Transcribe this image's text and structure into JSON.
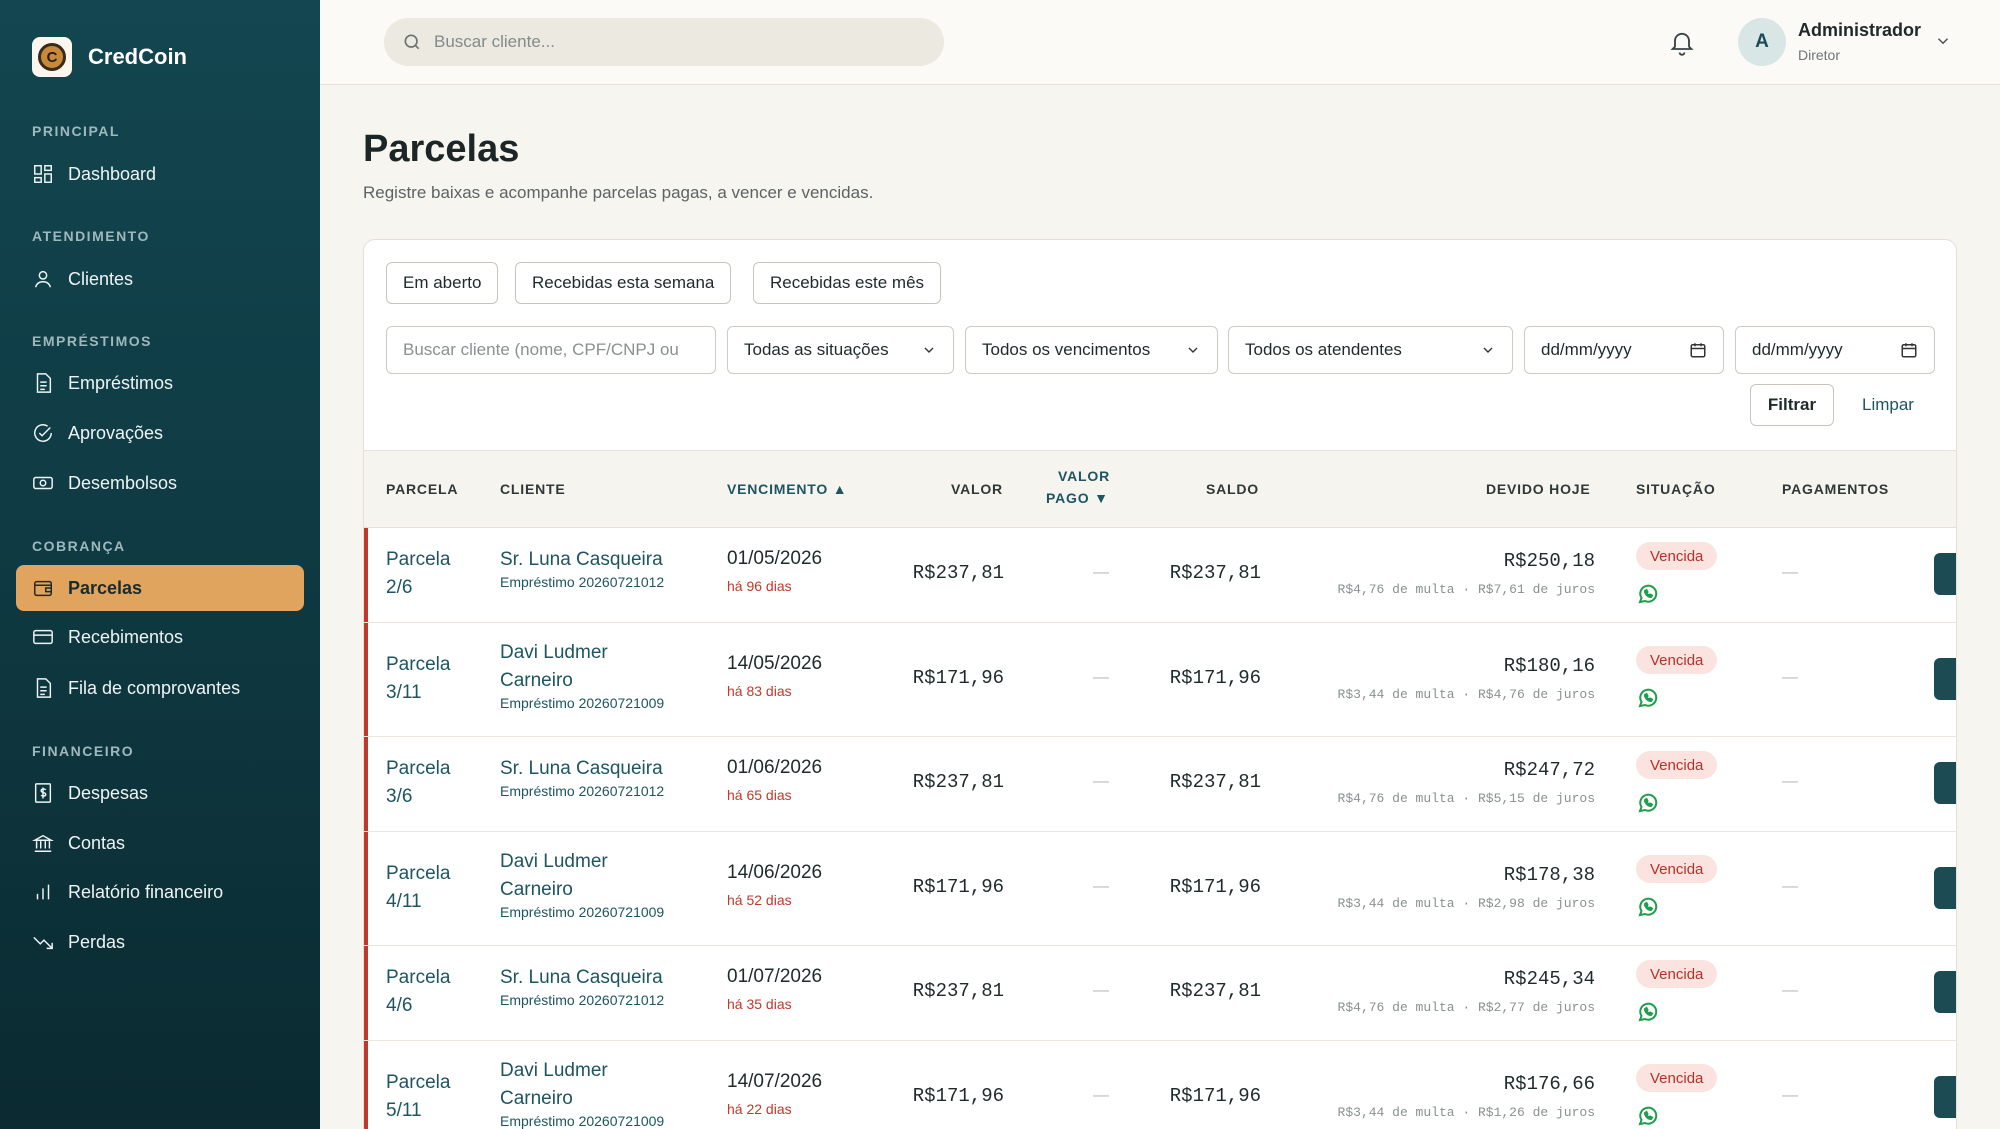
{
  "brand": {
    "name": "CredCoin",
    "logo_letter": "C"
  },
  "sidebar": {
    "sections": [
      {
        "label": "PRINCIPAL",
        "items": [
          {
            "label": "Dashboard",
            "icon": "grid-icon"
          }
        ]
      },
      {
        "label": "ATENDIMENTO",
        "items": [
          {
            "label": "Clientes",
            "icon": "user-icon"
          }
        ]
      },
      {
        "label": "EMPRÉSTIMOS",
        "items": [
          {
            "label": "Empréstimos",
            "icon": "document-icon"
          },
          {
            "label": "Aprovações",
            "icon": "check-circle-icon"
          },
          {
            "label": "Desembolsos",
            "icon": "cash-icon"
          }
        ]
      },
      {
        "label": "COBRANÇA",
        "items": [
          {
            "label": "Parcelas",
            "icon": "wallet-icon",
            "active": true
          },
          {
            "label": "Recebimentos",
            "icon": "card-icon"
          },
          {
            "label": "Fila de comprovantes",
            "icon": "document-icon"
          }
        ]
      },
      {
        "label": "FINANCEIRO",
        "items": [
          {
            "label": "Despesas",
            "icon": "dollar-doc-icon"
          },
          {
            "label": "Contas",
            "icon": "bank-icon"
          },
          {
            "label": "Relatório financeiro",
            "icon": "bar-chart-icon"
          },
          {
            "label": "Perdas",
            "icon": "trend-down-icon"
          }
        ]
      }
    ]
  },
  "header": {
    "search_placeholder": "Buscar cliente...",
    "user": {
      "initial": "A",
      "name": "Administrador",
      "role": "Diretor"
    }
  },
  "page": {
    "title": "Parcelas",
    "subtitle": "Registre baixas e acompanhe parcelas pagas, a vencer e vencidas."
  },
  "filters": {
    "chips": [
      "Em aberto",
      "Recebidas esta semana",
      "Recebidas este mês"
    ],
    "search_placeholder": "Buscar cliente (nome, CPF/CNPJ ou",
    "situacao": "Todas as situações",
    "vencimentos": "Todos os vencimentos",
    "atendentes": "Todos os atendentes",
    "date_from": "dd/mm/yyyy",
    "date_to": "dd/mm/yyyy",
    "filter_label": "Filtrar",
    "clear_label": "Limpar"
  },
  "table": {
    "headers": {
      "parcela": "PARCELA",
      "cliente": "CLIENTE",
      "vencimento": "VENCIMENTO ▲",
      "valor": "VALOR",
      "valor_pago_1": "VALOR",
      "valor_pago_2": "PAGO ▼",
      "saldo": "SALDO",
      "devido_hoje": "DEVIDO HOJE",
      "situacao": "SITUAÇÃO",
      "pagamentos": "PAGAMENTOS"
    },
    "rows": [
      {
        "parcela_1": "Parcela",
        "parcela_2": "2/6",
        "cliente_1": "Sr. Luna Casqueira",
        "cliente_2": "",
        "emprestimo": "Empréstimo 20260721012",
        "venc": "01/05/2026",
        "atraso": "há 96 dias",
        "valor": "R$237,81",
        "pago": "—",
        "saldo": "R$237,81",
        "devido": "R$250,18",
        "detalhe": "R$4,76 de multa · R$7,61 de juros",
        "situacao": "Vencida",
        "pagamentos": "—"
      },
      {
        "parcela_1": "Parcela",
        "parcela_2": "3/11",
        "cliente_1": "Davi Ludmer",
        "cliente_2": "Carneiro",
        "emprestimo": "Empréstimo 20260721009",
        "venc": "14/05/2026",
        "atraso": "há 83 dias",
        "valor": "R$171,96",
        "pago": "—",
        "saldo": "R$171,96",
        "devido": "R$180,16",
        "detalhe": "R$3,44 de multa · R$4,76 de juros",
        "situacao": "Vencida",
        "pagamentos": "—"
      },
      {
        "parcela_1": "Parcela",
        "parcela_2": "3/6",
        "cliente_1": "Sr. Luna Casqueira",
        "cliente_2": "",
        "emprestimo": "Empréstimo 20260721012",
        "venc": "01/06/2026",
        "atraso": "há 65 dias",
        "valor": "R$237,81",
        "pago": "—",
        "saldo": "R$237,81",
        "devido": "R$247,72",
        "detalhe": "R$4,76 de multa · R$5,15 de juros",
        "situacao": "Vencida",
        "pagamentos": "—"
      },
      {
        "parcela_1": "Parcela",
        "parcela_2": "4/11",
        "cliente_1": "Davi Ludmer",
        "cliente_2": "Carneiro",
        "emprestimo": "Empréstimo 20260721009",
        "venc": "14/06/2026",
        "atraso": "há 52 dias",
        "valor": "R$171,96",
        "pago": "—",
        "saldo": "R$171,96",
        "devido": "R$178,38",
        "detalhe": "R$3,44 de multa · R$2,98 de juros",
        "situacao": "Vencida",
        "pagamentos": "—"
      },
      {
        "parcela_1": "Parcela",
        "parcela_2": "4/6",
        "cliente_1": "Sr. Luna Casqueira",
        "cliente_2": "",
        "emprestimo": "Empréstimo 20260721012",
        "venc": "01/07/2026",
        "atraso": "há 35 dias",
        "valor": "R$237,81",
        "pago": "—",
        "saldo": "R$237,81",
        "devido": "R$245,34",
        "detalhe": "R$4,76 de multa · R$2,77 de juros",
        "situacao": "Vencida",
        "pagamentos": "—"
      },
      {
        "parcela_1": "Parcela",
        "parcela_2": "5/11",
        "cliente_1": "Davi Ludmer",
        "cliente_2": "Carneiro",
        "emprestimo": "Empréstimo 20260721009",
        "venc": "14/07/2026",
        "atraso": "há 22 dias",
        "valor": "R$171,96",
        "pago": "—",
        "saldo": "R$171,96",
        "devido": "R$176,66",
        "detalhe": "R$3,44 de multa · R$1,26 de juros",
        "situacao": "Vencida",
        "pagamentos": "—"
      }
    ]
  },
  "colors": {
    "sidebar": "#134650",
    "active": "#e0a45e",
    "accent": "#1d5560",
    "overdue": "#c0392b",
    "whatsapp": "#1e9d4a"
  }
}
